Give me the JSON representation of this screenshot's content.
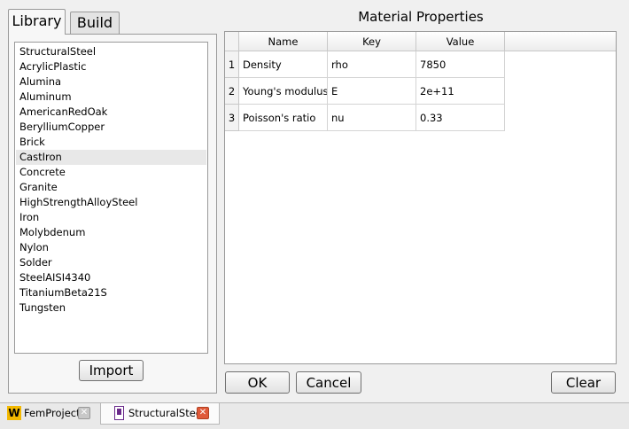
{
  "tabs": {
    "library": "Library",
    "build": "Build"
  },
  "library": {
    "items": [
      "StructuralSteel",
      "AcrylicPlastic",
      "Alumina",
      "Aluminum",
      "AmericanRedOak",
      "BerylliumCopper",
      "Brick",
      "CastIron",
      "Concrete",
      "Granite",
      "HighStrengthAlloySteel",
      "Iron",
      "Molybdenum",
      "Nylon",
      "Solder",
      "SteelAISI4340",
      "TitaniumBeta21S",
      "Tungsten"
    ],
    "selected_index": 7,
    "import_label": "Import"
  },
  "properties": {
    "title": "Material Properties",
    "columns": [
      "Name",
      "Key",
      "Value"
    ],
    "rows": [
      {
        "index": "1",
        "name": "Density",
        "key": "rho",
        "value": "7850"
      },
      {
        "index": "2",
        "name": "Young's modulus",
        "key": "E",
        "value": "2e+11"
      },
      {
        "index": "3",
        "name": "Poisson's ratio",
        "key": "nu",
        "value": "0.33"
      }
    ],
    "ok_label": "OK",
    "cancel_label": "Cancel",
    "clear_label": "Clear"
  },
  "documents": [
    {
      "label": "FemProject",
      "icon": "workbench-w-icon",
      "active": false
    },
    {
      "label": "StructuralSteel",
      "icon": "material-document-icon",
      "active": true
    }
  ],
  "colors": {
    "close_inactive": "#c8c8c8",
    "close_active": "#e05a3a",
    "w_icon": "#f2b800",
    "doc_icon": "#6a2a8a"
  }
}
